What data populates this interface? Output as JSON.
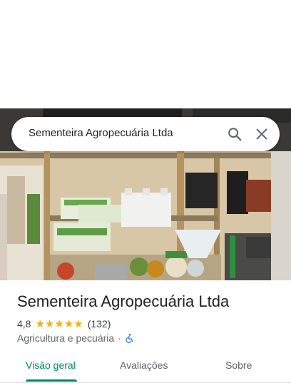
{
  "search": {
    "query": "Sementeira Agropecuária Ltda"
  },
  "place": {
    "name": "Sementeira Agropecuária Ltda",
    "rating": "4,8",
    "stars": 5,
    "review_count": "(132)",
    "category": "Agricultura e pecuária",
    "separator": "·"
  },
  "tabs": [
    {
      "label": "Visão geral",
      "active": true
    },
    {
      "label": "Avaliações",
      "active": false
    },
    {
      "label": "Sobre",
      "active": false
    }
  ],
  "colors": {
    "accent": "#01875f",
    "star": "#f5b400",
    "accessibility": "#1a73e8"
  },
  "icons": {
    "search": "search-icon",
    "close": "close-icon",
    "accessibility": "wheelchair-icon"
  }
}
